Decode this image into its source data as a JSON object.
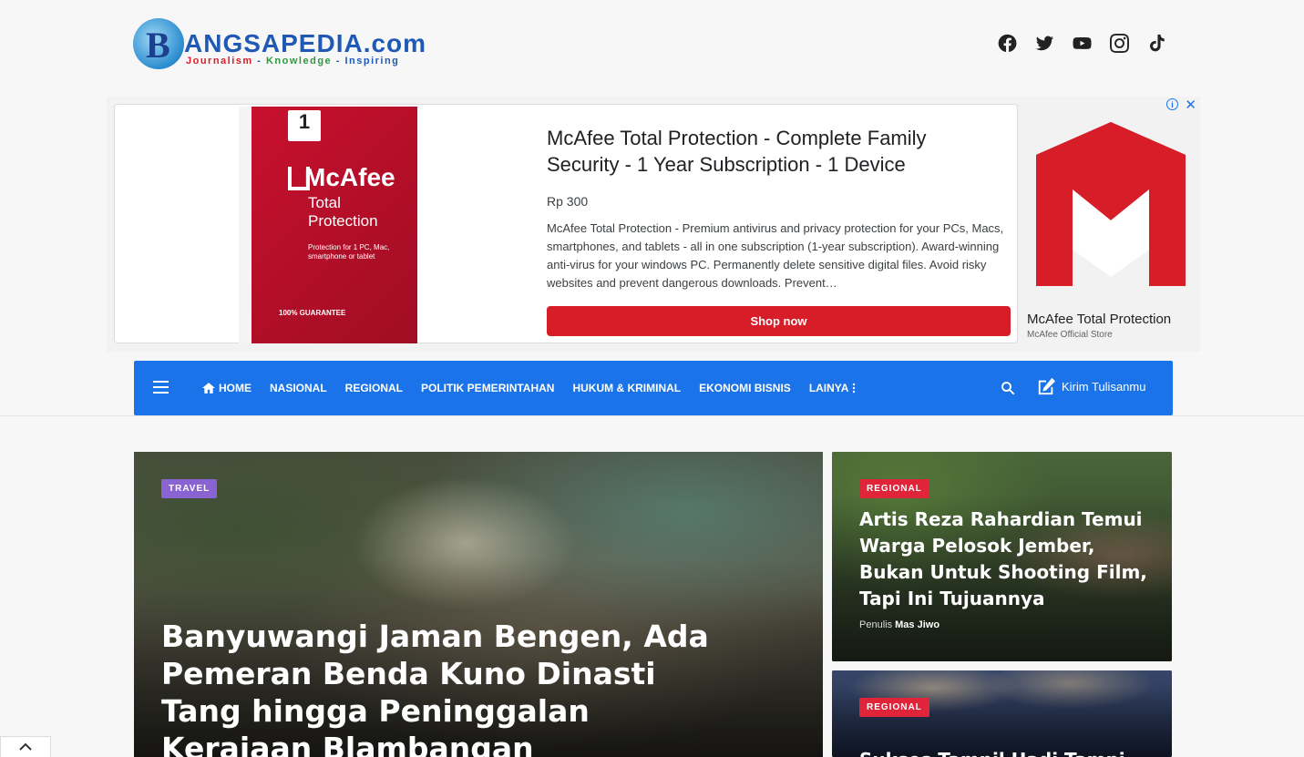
{
  "logo": {
    "name": "ANGSAPEDIA.com",
    "initial": "B",
    "tagline_1": "Journalism",
    "sep_1": "-",
    "tagline_2": "Knowledge",
    "sep_2": "-",
    "tagline_3": "Inspiring"
  },
  "socials": [
    "facebook-icon",
    "twitter-icon",
    "youtube-icon",
    "instagram-icon",
    "tiktok-icon"
  ],
  "ad": {
    "title": "McAfee Total Protection - Complete Family Security - 1 Year Subscription - 1 Device",
    "price": "Rp 300",
    "description": "McAfee Total Protection - Premium antivirus and privacy protection for your PCs, Macs, smartphones, and tablets - all in one subscription (1-year subscription). Award-winning anti-virus for your windows PC. Permanently delete sensitive digital files. Avoid risky websites and prevent dangerous downloads. Prevent…",
    "cta": "Shop now",
    "brand_title": "McAfee Total Protection",
    "brand_sub": "McAfee Official Store",
    "box_num": "1",
    "box_brand": "McAfee",
    "box_title_1": "Total",
    "box_title_2": "Protection",
    "box_small": "Protection for 1 PC, Mac, smartphone or tablet",
    "box_guar": "100% GUARANTEE",
    "info": "i",
    "close": "✕",
    "colors": {
      "brand_red": "#d71e28",
      "link_blue": "#1a73e8"
    }
  },
  "nav": {
    "items": [
      {
        "label": "HOME",
        "icon": "home-icon"
      },
      {
        "label": "NASIONAL"
      },
      {
        "label": "REGIONAL"
      },
      {
        "label": "POLITIK PEMERINTAHAN"
      },
      {
        "label": "HUKUM & KRIMINAL"
      },
      {
        "label": "EKONOMI BISNIS"
      },
      {
        "label": "LAINYA",
        "icon": "more-vertical-icon"
      }
    ],
    "write_label": "Kirim Tulisanmu",
    "accent": "#1a73e8"
  },
  "featured": {
    "category": "TRAVEL",
    "title": "Banyuwangi Jaman Bengen, Ada Pemeran Benda Kuno Dinasti Tang hingga Peninggalan Kerajaan Blambangan",
    "category_color": "#8a63d2"
  },
  "side_posts": [
    {
      "category": "REGIONAL",
      "title": "Artis Reza Rahardian Temui Warga Pelosok Jember, Bukan Untuk Shooting Film, Tapi Ini Tujuannya",
      "author_prefix": "Penulis",
      "author": "Mas Jiwo"
    },
    {
      "category": "REGIONAL",
      "title": "Sukses Tampil Hadi Tampi"
    }
  ],
  "category_color_regional": "#e0243a"
}
